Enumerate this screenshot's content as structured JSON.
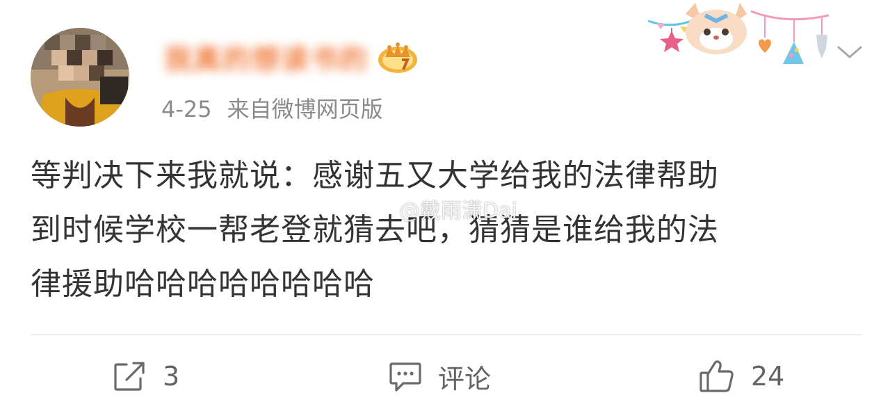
{
  "post": {
    "username": "我真的想读书的",
    "time": "4-25",
    "source": "来自微博网页版",
    "content_lines": [
      "等判决下来我就说：感谢五又大学给我的法律帮助",
      "到时候学校一帮老登就猜去吧，猜猜是谁给我的法",
      "律援助哈哈哈哈哈哈哈哈"
    ],
    "watermark": "@戴雨潇Dai"
  },
  "actions": {
    "repost_count": "3",
    "comment_label": "评论",
    "like_count": "24"
  },
  "icons": {
    "avatar": "avatar",
    "vip_badge": "crown-badge-icon",
    "decoration": "cartoon-fox-bunting-decoration",
    "chevron": "chevron-down-icon",
    "repost": "repost-icon",
    "comment": "comment-icon",
    "like": "thumbs-up-icon"
  },
  "colors": {
    "username": "#f07a3a",
    "meta": "#8a8a8a",
    "content": "#333333",
    "action": "#636363",
    "divider": "#eeeeee"
  }
}
